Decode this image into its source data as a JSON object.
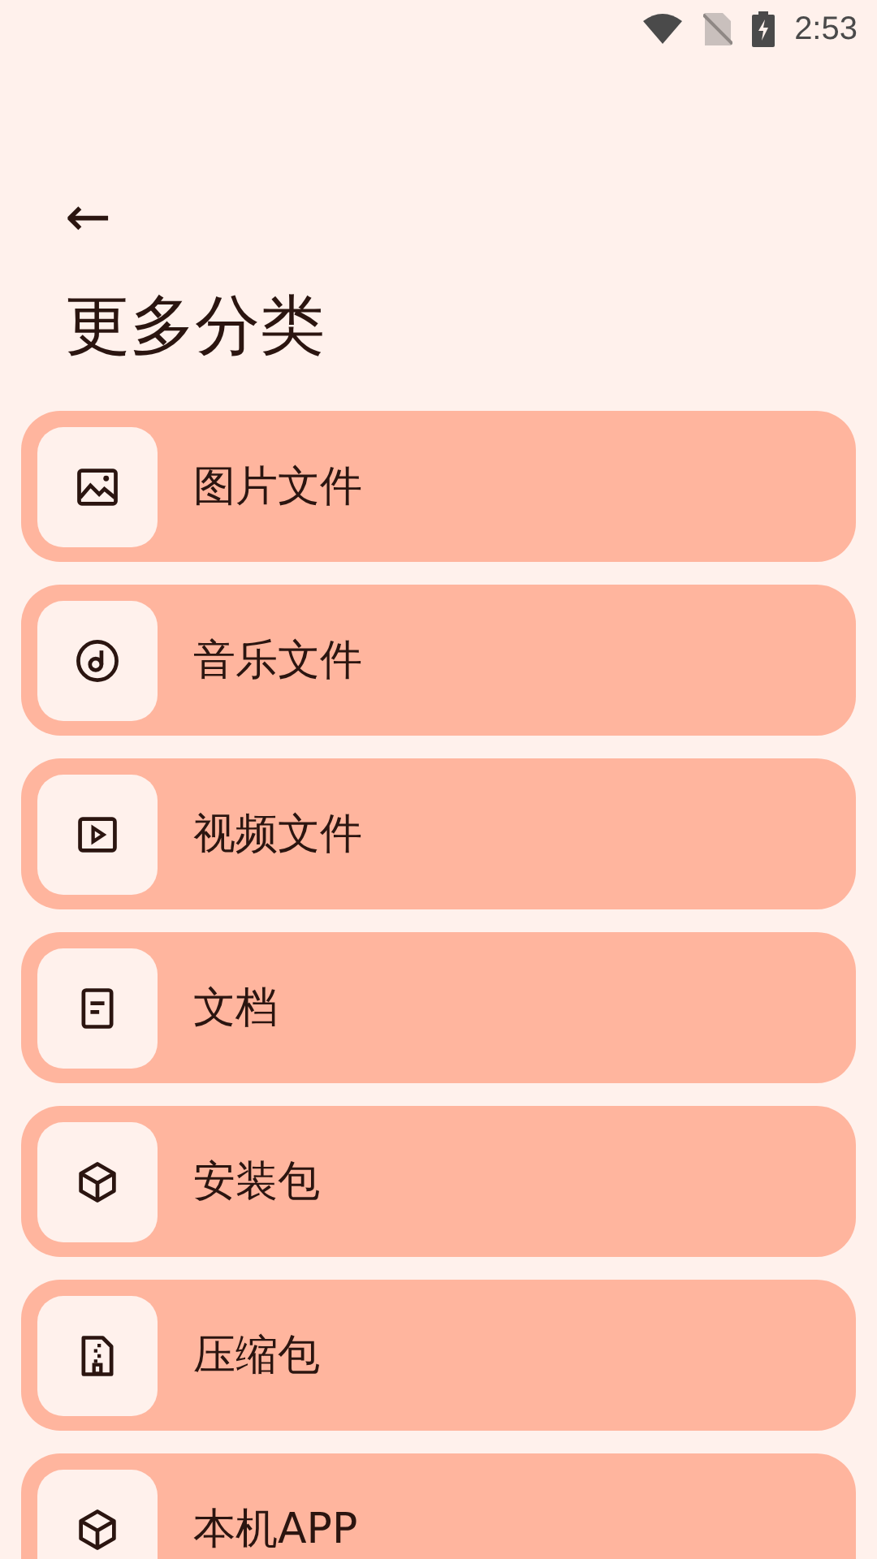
{
  "status_bar": {
    "time": "2:53"
  },
  "header": {
    "back": "←",
    "title": "更多分类"
  },
  "categories": [
    {
      "kind": "image",
      "label": "图片文件"
    },
    {
      "kind": "music",
      "label": "音乐文件"
    },
    {
      "kind": "video",
      "label": "视频文件"
    },
    {
      "kind": "document",
      "label": "文档"
    },
    {
      "kind": "package",
      "label": "安装包"
    },
    {
      "kind": "archive",
      "label": "压缩包"
    },
    {
      "kind": "package",
      "label": "本机APP"
    }
  ]
}
